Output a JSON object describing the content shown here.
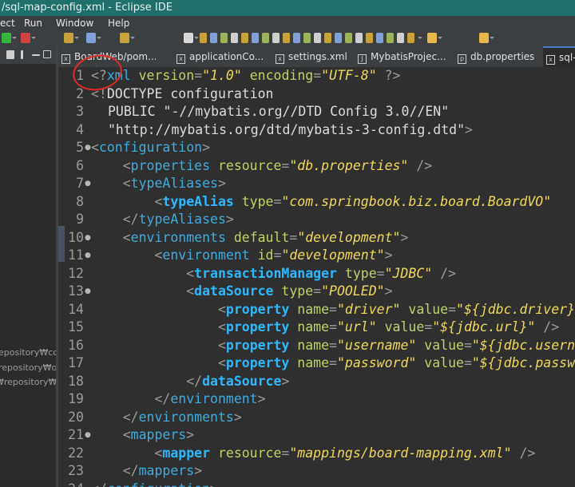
{
  "window": {
    "title": "/sql-map-config.xml - Eclipse IDE"
  },
  "menu": {
    "items": [
      {
        "label": "ect"
      },
      {
        "label": "Run"
      },
      {
        "label": "Window"
      },
      {
        "label": "Help"
      }
    ]
  },
  "toolbar_icons": [
    {
      "name": "run-icon",
      "color": "#35b540"
    },
    {
      "name": "debug-icon",
      "color": "#d04242"
    },
    {
      "name": "stop-icon",
      "color": "#c9a13a"
    },
    {
      "name": "new-icon",
      "color": "#7fa0d8"
    },
    {
      "name": "save-icon",
      "color": "#c9a13a"
    },
    {
      "name": "search-icon",
      "color": "#d8d8d8"
    },
    {
      "name": "back-icon",
      "color": "#e7b84a"
    },
    {
      "name": "forward-icon",
      "color": "#e7b84a"
    }
  ],
  "left_panel": {
    "items": [
      {
        "text": "epository₩com"
      },
      {
        "text": "repository₩o"
      },
      {
        "text": "₩repository₩o"
      }
    ]
  },
  "tabs": [
    {
      "label": "BoardWeb/pom....",
      "icon": "xml-file-icon",
      "active": false
    },
    {
      "label": "applicationCo...",
      "icon": "xml-file-icon",
      "active": false
    },
    {
      "label": "settings.xml",
      "icon": "xml-file-icon",
      "active": false
    },
    {
      "label": "MybatisProjec...",
      "icon": "java-file-icon",
      "active": false
    },
    {
      "label": "db.properties",
      "icon": "properties-file-icon",
      "active": false
    },
    {
      "label": "sql-",
      "icon": "xml-file-icon",
      "active": true
    }
  ],
  "editor": {
    "lines": [
      {
        "n": "1",
        "fold": "",
        "segs": [
          [
            "pi",
            "<?"
          ],
          [
            "tag",
            "xml"
          ],
          [
            "attr",
            " version"
          ],
          [
            "punc",
            "="
          ],
          [
            "val",
            "\"1.0\""
          ],
          [
            "attr",
            " encoding"
          ],
          [
            "punc",
            "="
          ],
          [
            "val",
            "\"UTF-8\""
          ],
          [
            "pi",
            " ?>"
          ]
        ]
      },
      {
        "n": "2",
        "fold": "",
        "segs": [
          [
            "pi",
            "<!"
          ],
          [
            "kw",
            "DOCTYPE configuration"
          ]
        ]
      },
      {
        "n": "3",
        "fold": "",
        "segs": [
          [
            "kw",
            "PUBLIC \"-//mybatis.org//DTD Config 3.0//EN\""
          ]
        ]
      },
      {
        "n": "4",
        "fold": "",
        "segs": [
          [
            "kw",
            "\"http://mybatis.org/dtd/mybatis-3-config.dtd\""
          ],
          [
            "punc",
            ">"
          ]
        ]
      },
      {
        "n": "5",
        "fold": "●",
        "segs": [
          [
            "punc",
            "<"
          ],
          [
            "tag",
            "configuration"
          ],
          [
            "punc",
            ">"
          ]
        ]
      },
      {
        "n": "6",
        "fold": "",
        "segs": [
          [
            "punc",
            "    <"
          ],
          [
            "tag",
            "properties"
          ],
          [
            "attr",
            " resource"
          ],
          [
            "punc",
            "="
          ],
          [
            "val",
            "\"db.properties\""
          ],
          [
            "punc",
            " />"
          ]
        ]
      },
      {
        "n": "7",
        "fold": "●",
        "segs": [
          [
            "punc",
            "    <"
          ],
          [
            "tag",
            "typeAliases"
          ],
          [
            "punc",
            ">"
          ]
        ]
      },
      {
        "n": "8",
        "fold": "",
        "segs": [
          [
            "punc",
            "        <"
          ],
          [
            "tagb",
            "typeAlias"
          ],
          [
            "attr",
            " type"
          ],
          [
            "punc",
            "="
          ],
          [
            "val",
            "\"com.springbook.biz.board.BoardVO\""
          ]
        ]
      },
      {
        "n": "9",
        "fold": "",
        "segs": [
          [
            "punc",
            "    </"
          ],
          [
            "tag",
            "typeAliases"
          ],
          [
            "punc",
            ">"
          ]
        ]
      },
      {
        "n": "10",
        "fold": "●",
        "segs": [
          [
            "punc",
            "    <"
          ],
          [
            "tag",
            "environments"
          ],
          [
            "attr",
            " default"
          ],
          [
            "punc",
            "="
          ],
          [
            "val",
            "\"development\""
          ],
          [
            "punc",
            ">"
          ]
        ]
      },
      {
        "n": "11",
        "fold": "●",
        "segs": [
          [
            "punc",
            "        <"
          ],
          [
            "tag",
            "environment"
          ],
          [
            "attr",
            " id"
          ],
          [
            "punc",
            "="
          ],
          [
            "val",
            "\"development\""
          ],
          [
            "punc",
            ">"
          ]
        ]
      },
      {
        "n": "12",
        "fold": "",
        "segs": [
          [
            "punc",
            "            <"
          ],
          [
            "tagb",
            "transactionManager"
          ],
          [
            "attr",
            " type"
          ],
          [
            "punc",
            "="
          ],
          [
            "val",
            "\"JDBC\""
          ],
          [
            "punc",
            " />"
          ]
        ]
      },
      {
        "n": "13",
        "fold": "●",
        "segs": [
          [
            "punc",
            "            <"
          ],
          [
            "tagb",
            "dataSource"
          ],
          [
            "attr",
            " type"
          ],
          [
            "punc",
            "="
          ],
          [
            "val",
            "\"POOLED\""
          ],
          [
            "punc",
            ">"
          ]
        ]
      },
      {
        "n": "14",
        "fold": "",
        "segs": [
          [
            "punc",
            "                <"
          ],
          [
            "tagb",
            "property"
          ],
          [
            "attr",
            " name"
          ],
          [
            "punc",
            "="
          ],
          [
            "val",
            "\"driver\""
          ],
          [
            "attr",
            " value"
          ],
          [
            "punc",
            "="
          ],
          [
            "val",
            "\"${jdbc.driver}\""
          ]
        ]
      },
      {
        "n": "15",
        "fold": "",
        "segs": [
          [
            "punc",
            "                <"
          ],
          [
            "tagb",
            "property"
          ],
          [
            "attr",
            " name"
          ],
          [
            "punc",
            "="
          ],
          [
            "val",
            "\"url\""
          ],
          [
            "attr",
            " value"
          ],
          [
            "punc",
            "="
          ],
          [
            "val",
            "\"${jdbc.url}\""
          ],
          [
            "punc",
            " />"
          ]
        ]
      },
      {
        "n": "16",
        "fold": "",
        "segs": [
          [
            "punc",
            "                <"
          ],
          [
            "tagb",
            "property"
          ],
          [
            "attr",
            " name"
          ],
          [
            "punc",
            "="
          ],
          [
            "val",
            "\"username\""
          ],
          [
            "attr",
            " value"
          ],
          [
            "punc",
            "="
          ],
          [
            "val",
            "\"${jdbc.username}\""
          ]
        ]
      },
      {
        "n": "17",
        "fold": "",
        "segs": [
          [
            "punc",
            "                <"
          ],
          [
            "tagb",
            "property"
          ],
          [
            "attr",
            " name"
          ],
          [
            "punc",
            "="
          ],
          [
            "val",
            "\"password\""
          ],
          [
            "attr",
            " value"
          ],
          [
            "punc",
            "="
          ],
          [
            "val",
            "\"${jdbc.password}\""
          ]
        ]
      },
      {
        "n": "18",
        "fold": "",
        "segs": [
          [
            "punc",
            "            </"
          ],
          [
            "tagb",
            "dataSource"
          ],
          [
            "punc",
            ">"
          ]
        ]
      },
      {
        "n": "19",
        "fold": "",
        "segs": [
          [
            "punc",
            "        </"
          ],
          [
            "tag",
            "environment"
          ],
          [
            "punc",
            ">"
          ]
        ]
      },
      {
        "n": "20",
        "fold": "",
        "segs": [
          [
            "punc",
            "    </"
          ],
          [
            "tag",
            "environments"
          ],
          [
            "punc",
            ">"
          ]
        ]
      },
      {
        "n": "21",
        "fold": "●",
        "segs": [
          [
            "punc",
            "    <"
          ],
          [
            "tag",
            "mappers"
          ],
          [
            "punc",
            ">"
          ]
        ]
      },
      {
        "n": "22",
        "fold": "",
        "segs": [
          [
            "punc",
            "        <"
          ],
          [
            "tagb",
            "mapper"
          ],
          [
            "attr",
            " resource"
          ],
          [
            "punc",
            "="
          ],
          [
            "val",
            "\"mappings/board-mapping.xml\""
          ],
          [
            "punc",
            " />"
          ]
        ]
      },
      {
        "n": "23",
        "fold": "",
        "segs": [
          [
            "punc",
            "    </"
          ],
          [
            "tag",
            "mappers"
          ],
          [
            "punc",
            ">"
          ]
        ]
      },
      {
        "n": "24",
        "fold": "",
        "segs": [
          [
            "punc",
            "</"
          ],
          [
            "tag",
            "configuration"
          ],
          [
            "punc",
            ">"
          ]
        ]
      }
    ]
  }
}
